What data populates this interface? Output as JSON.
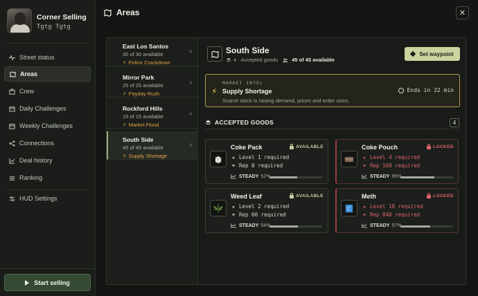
{
  "profile": {
    "name": "Corner Selling",
    "sub": "Tgtg Tgtg"
  },
  "nav": [
    {
      "label": "Street status",
      "icon": "pulse-icon",
      "active": false
    },
    {
      "label": "Areas",
      "icon": "map-icon",
      "active": true
    },
    {
      "label": "Crew",
      "icon": "crew-icon",
      "active": false
    },
    {
      "label": "Daily Challenges",
      "icon": "calendar-icon",
      "active": false
    },
    {
      "label": "Weekly Challenges",
      "icon": "calendar-icon",
      "active": false
    },
    {
      "label": "Connections",
      "icon": "share-icon",
      "active": false
    },
    {
      "label": "Deal history",
      "icon": "chart-icon",
      "active": false
    },
    {
      "label": "Ranking",
      "icon": "ranking-icon",
      "active": false
    }
  ],
  "hud": {
    "label": "HUD Settings"
  },
  "start": {
    "label": "Start selling"
  },
  "header": {
    "title": "Areas",
    "close": "✕"
  },
  "areas": [
    {
      "name": "East Los Santos",
      "availability": "30 of 30 available",
      "event": "Police Crackdown",
      "active": false
    },
    {
      "name": "Mirror Park",
      "availability": "25 of 25 available",
      "event": "Payday Rush",
      "active": false
    },
    {
      "name": "Rockford Hills",
      "availability": "15 of 15 available",
      "event": "Market Flood",
      "active": false
    },
    {
      "name": "South Side",
      "availability": "45 of 45 available",
      "event": "Supply Shortage",
      "active": true
    }
  ],
  "detail": {
    "title": "South Side",
    "accepted": "4 · Accepted goods",
    "available": "45 of 45 available",
    "waypoint": "Set waypoint"
  },
  "intel": {
    "label": "MARKET INTEL",
    "title": "Supply Shortage",
    "desc": "Scarce stock is raising demand, prices and order sizes.",
    "timer": "Ends in 22 min"
  },
  "goods": {
    "heading": "ACCEPTED GOODS",
    "count": "4",
    "items": [
      {
        "name": "Coke Pack",
        "status": "AVAILABLE",
        "locked": false,
        "level": "Level 1 required",
        "rep": "Rep 0 required",
        "trend": "STEADY",
        "pct": "52%",
        "fill": 0.52,
        "icon": "coke-pack-icon"
      },
      {
        "name": "Coke Pouch",
        "status": "LOCKED",
        "locked": true,
        "level": "Level 4 required",
        "rep": "Rep 160 required",
        "trend": "STEADY",
        "pct": "65%",
        "fill": 0.65,
        "icon": "coke-pouch-icon"
      },
      {
        "name": "Weed Leaf",
        "status": "AVAILABLE",
        "locked": false,
        "level": "Level 2 required",
        "rep": "Rep 60 required",
        "trend": "STEADY",
        "pct": "54%",
        "fill": 0.54,
        "icon": "weed-leaf-icon"
      },
      {
        "name": "Meth",
        "status": "LOCKED",
        "locked": true,
        "level": "Level 18 required",
        "rep": "Rep 840 required",
        "trend": "STEADY",
        "pct": "57%",
        "fill": 0.57,
        "icon": "meth-icon"
      }
    ]
  },
  "colors": {
    "accent": "#c9d49e",
    "event": "#e3a348",
    "locked": "#e0666f",
    "intel_border": "#b59a4f"
  }
}
